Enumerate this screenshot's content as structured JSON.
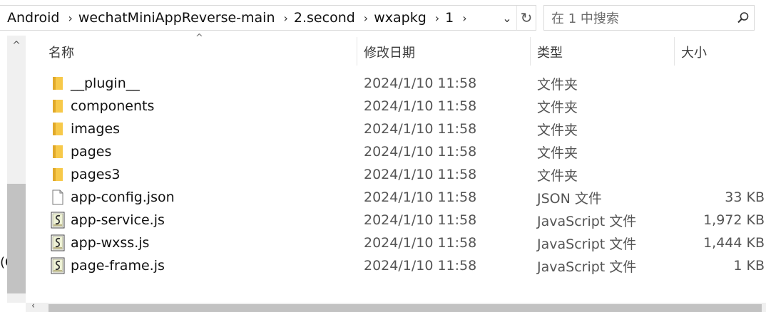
{
  "address": {
    "crumbs": [
      "Android",
      "wechatMiniAppReverse-main",
      "2.second",
      "wxapkg",
      "1"
    ],
    "separator": "›"
  },
  "search": {
    "placeholder": "在 1 中搜索"
  },
  "left_pane": {
    "cut_text": "(C"
  },
  "columns": {
    "name": "名称",
    "date": "修改日期",
    "type": "类型",
    "size": "大小"
  },
  "files": [
    {
      "name": "__plugin__",
      "date": "2024/1/10 11:58",
      "type": "文件夹",
      "size": "",
      "icon": "folder-icon"
    },
    {
      "name": "components",
      "date": "2024/1/10 11:58",
      "type": "文件夹",
      "size": "",
      "icon": "folder-icon"
    },
    {
      "name": "images",
      "date": "2024/1/10 11:58",
      "type": "文件夹",
      "size": "",
      "icon": "folder-icon"
    },
    {
      "name": "pages",
      "date": "2024/1/10 11:58",
      "type": "文件夹",
      "size": "",
      "icon": "folder-icon"
    },
    {
      "name": "pages3",
      "date": "2024/1/10 11:58",
      "type": "文件夹",
      "size": "",
      "icon": "folder-icon"
    },
    {
      "name": "app-config.json",
      "date": "2024/1/10 11:58",
      "type": "JSON 文件",
      "size": "33 KB",
      "icon": "file-icon"
    },
    {
      "name": "app-service.js",
      "date": "2024/1/10 11:58",
      "type": "JavaScript 文件",
      "size": "1,972 KB",
      "icon": "script-file-icon"
    },
    {
      "name": "app-wxss.js",
      "date": "2024/1/10 11:58",
      "type": "JavaScript 文件",
      "size": "1,444 KB",
      "icon": "script-file-icon"
    },
    {
      "name": "page-frame.js",
      "date": "2024/1/10 11:58",
      "type": "JavaScript 文件",
      "size": "1 KB",
      "icon": "script-file-icon"
    }
  ],
  "colors": {
    "folder": "#f7c94a",
    "folder_dark": "#e1a92a",
    "scroll_thumb": "#c2c2c2"
  }
}
